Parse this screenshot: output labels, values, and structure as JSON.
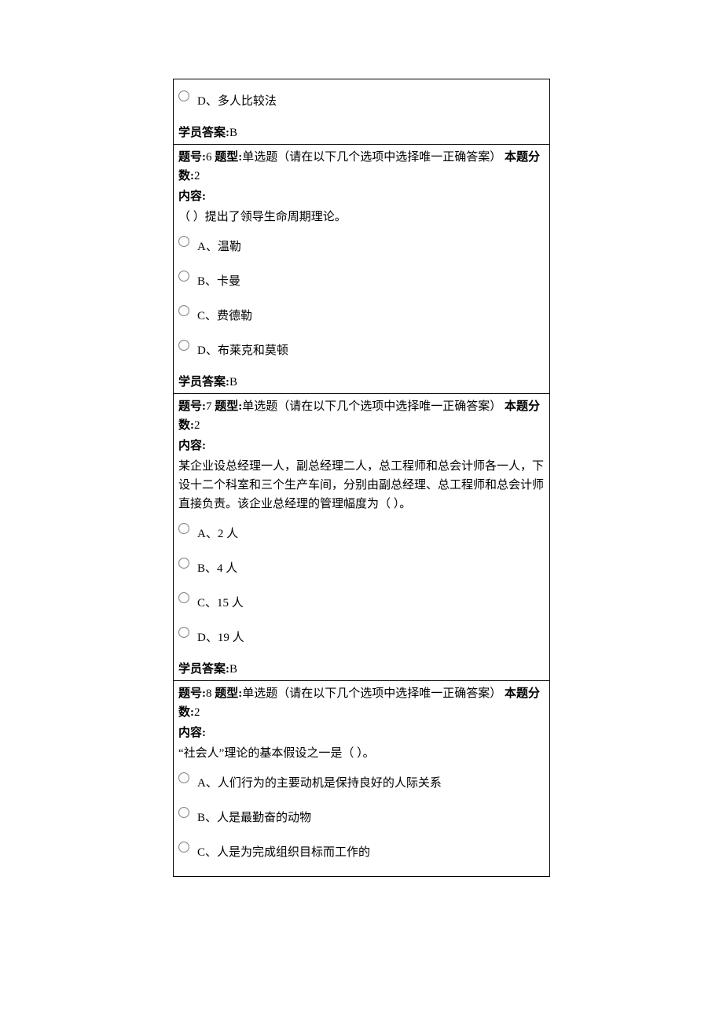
{
  "box1": {
    "option_d": "D、多人比较法",
    "answer_label": "学员答案:",
    "answer_value": "B"
  },
  "q6": {
    "num_label": "题号:",
    "num": "6",
    "type_label": "题型:",
    "type_text": "单选题（请在以下几个选项中选择唯一正确答案）",
    "score_label": "本题分数:",
    "score": "2",
    "content_label": "内容:",
    "content": "（ ）提出了领导生命周期理论。",
    "opt_a": "A、温勒",
    "opt_b": "B、卡曼",
    "opt_c": "C、费德勒",
    "opt_d": "D、布莱克和莫顿",
    "answer_label": "学员答案:",
    "answer_value": "B"
  },
  "q7": {
    "num_label": "题号:",
    "num": "7",
    "type_label": "题型:",
    "type_text": "单选题（请在以下几个选项中选择唯一正确答案）",
    "score_label": "本题分数:",
    "score": "2",
    "content_label": "内容:",
    "content": "某企业设总经理一人，副总经理二人，总工程师和总会计师各一人，下设十二个科室和三个生产车间，分别由副总经理、总工程师和总会计师直接负责。该企业总经理的管理幅度为（ ）。",
    "opt_a": "A、2 人",
    "opt_b": "B、4 人",
    "opt_c": "C、15 人",
    "opt_d": "D、19 人",
    "answer_label": "学员答案:",
    "answer_value": "B"
  },
  "q8": {
    "num_label": "题号:",
    "num": "8",
    "type_label": "题型:",
    "type_text": "单选题（请在以下几个选项中选择唯一正确答案）",
    "score_label": "本题分数:",
    "score": "2",
    "content_label": "内容:",
    "content": "“社会人”理论的基本假设之一是（  ）。",
    "opt_a": "A、人们行为的主要动机是保持良好的人际关系",
    "opt_b": "B、人是最勤奋的动物",
    "opt_c": "C、人是为完成组织目标而工作的"
  }
}
